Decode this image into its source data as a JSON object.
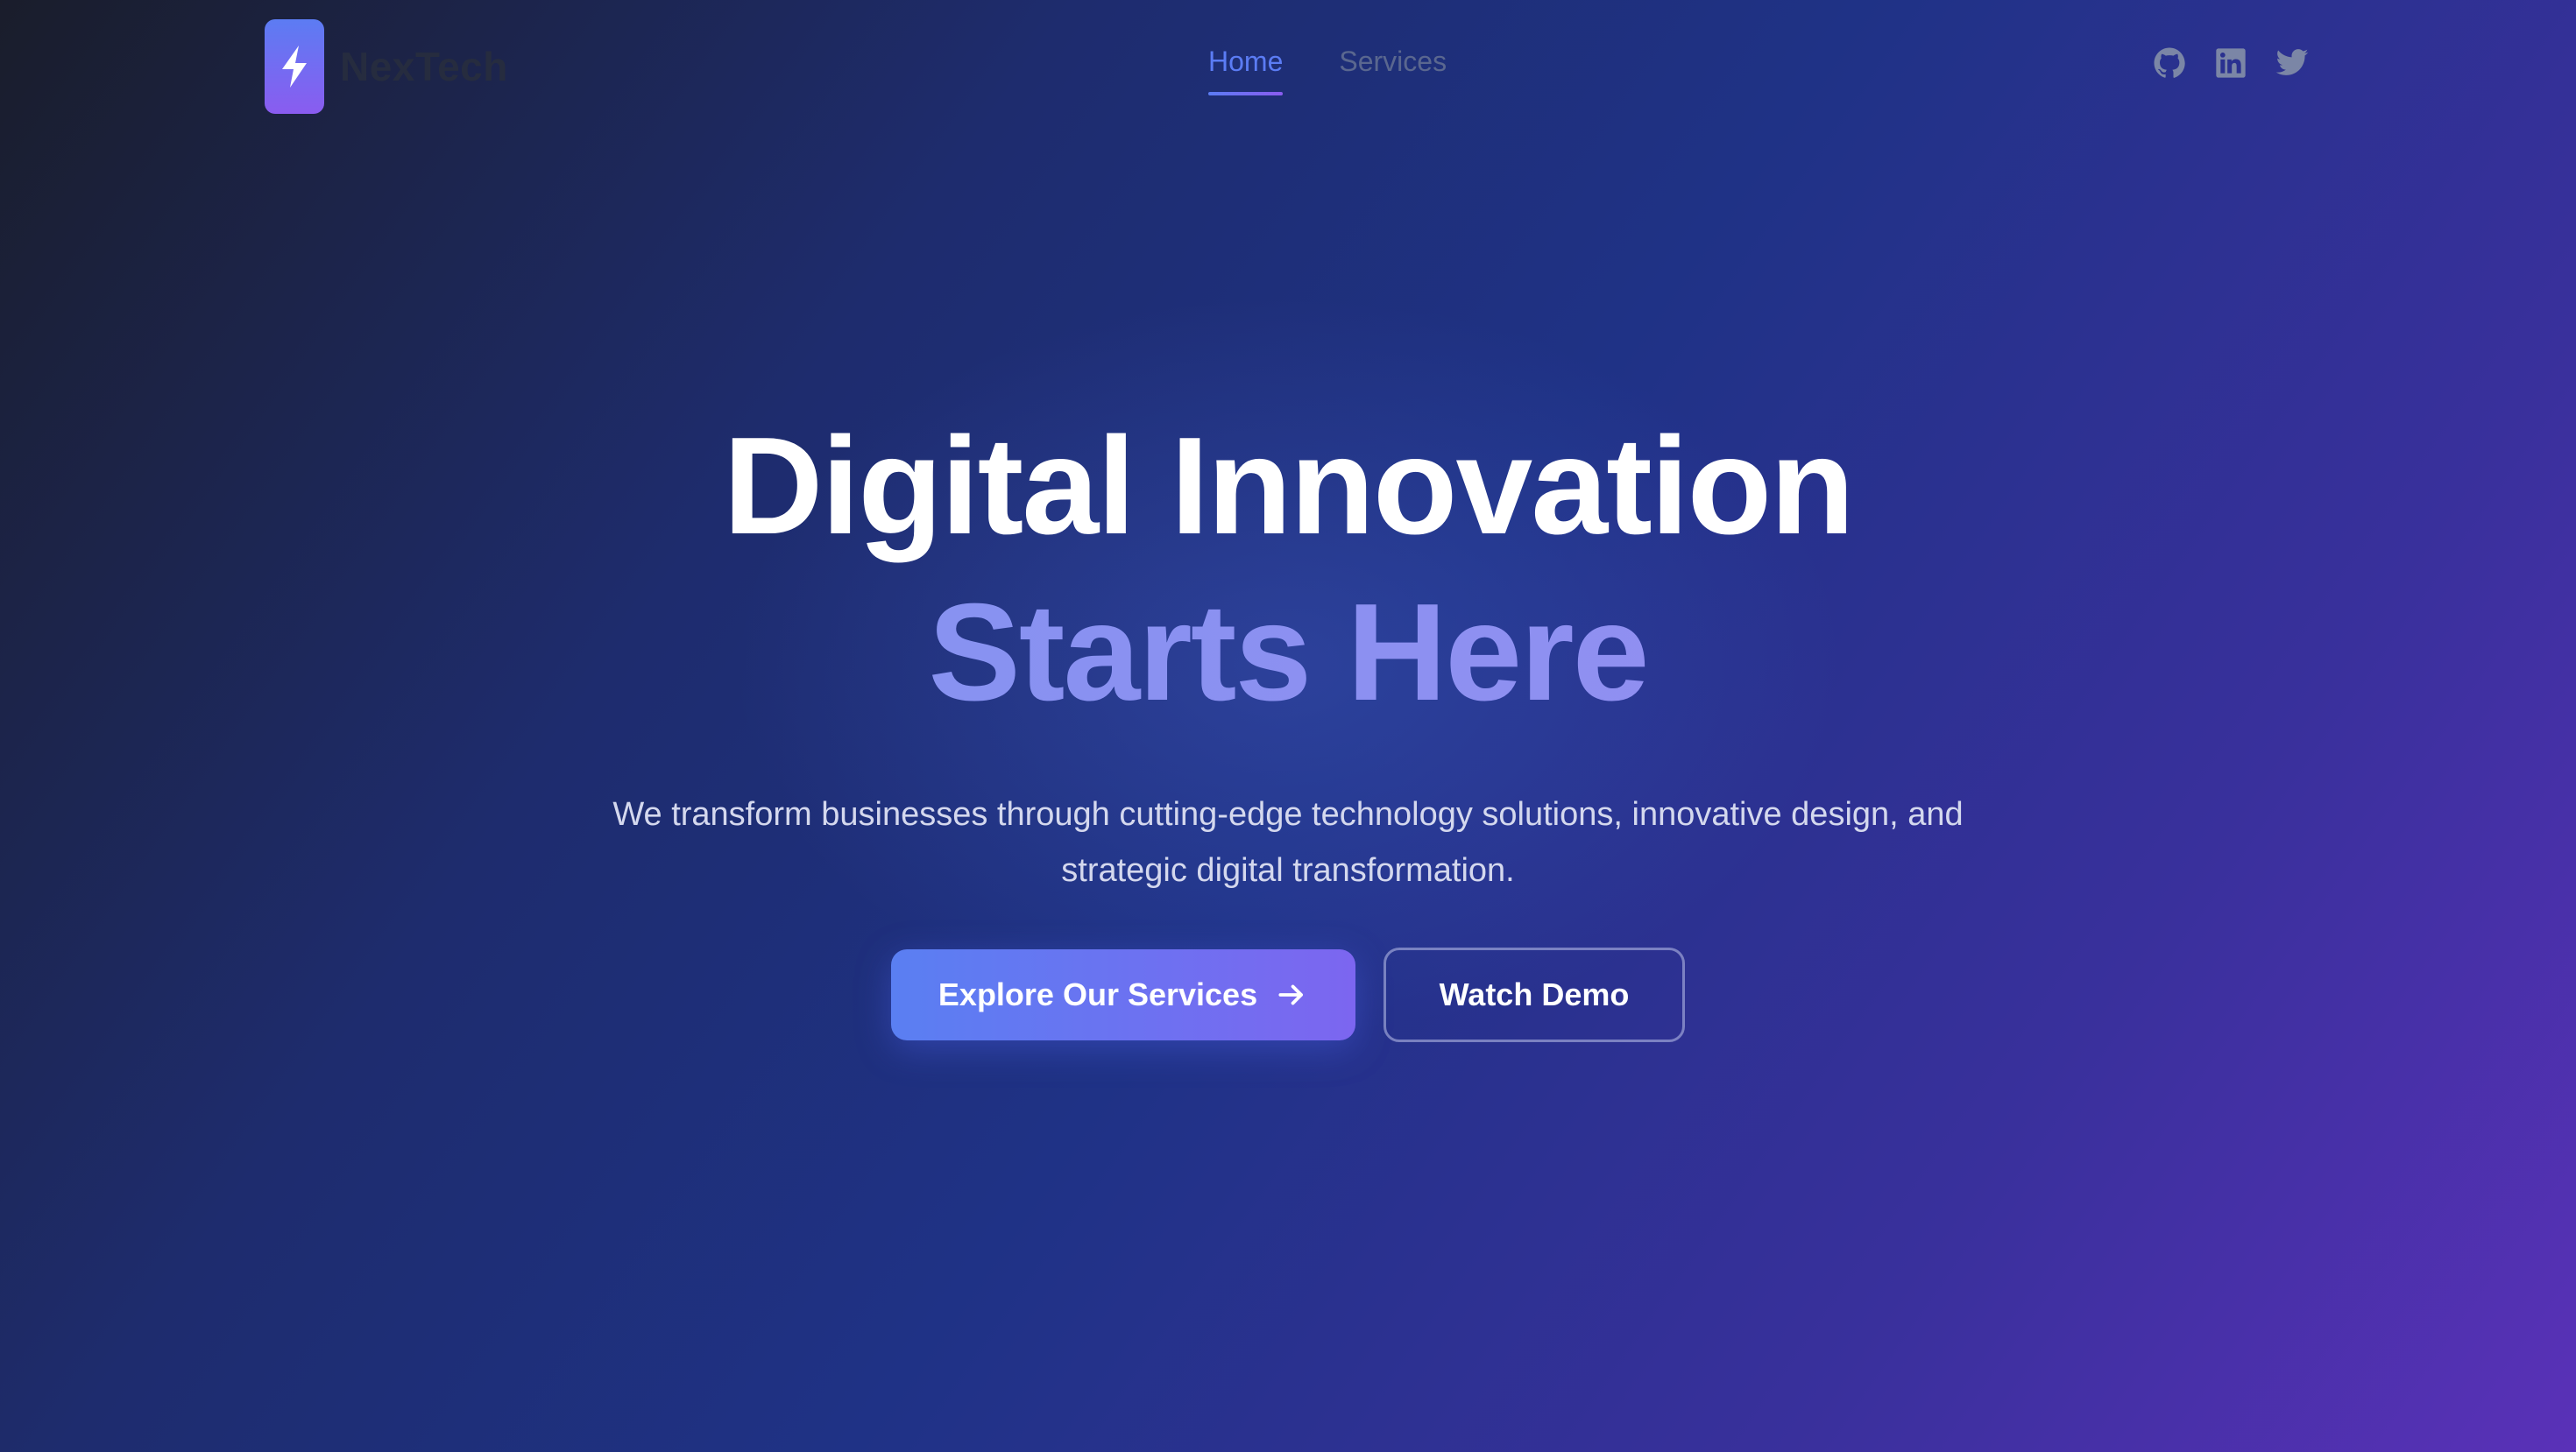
{
  "brand": {
    "name": "NexTech",
    "icon": "lightning-bolt-icon"
  },
  "nav": {
    "items": [
      {
        "label": "Home",
        "active": true
      },
      {
        "label": "Services",
        "active": false
      }
    ]
  },
  "social": {
    "icons": [
      "github-icon",
      "linkedin-icon",
      "twitter-icon"
    ]
  },
  "hero": {
    "title_line1": "Digital Innovation",
    "title_line2": "Starts Here",
    "description": "We transform businesses through cutting-edge technology solutions, innovative design, and strategic digital transformation.",
    "primary_cta": "Explore Our Services",
    "primary_cta_icon": "arrow-right-icon",
    "secondary_cta": "Watch Demo"
  },
  "colors": {
    "accent": "#5b7cf4",
    "accent_purple": "#8a5cf0",
    "background_dark": "#1a1d2b",
    "background_blue": "#1f3286",
    "background_purple": "#5a31b8"
  }
}
